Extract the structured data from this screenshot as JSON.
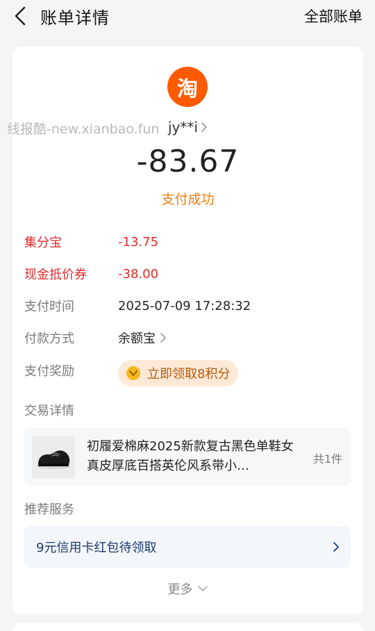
{
  "header": {
    "title": "账单详情",
    "all_bills": "全部账单"
  },
  "merchant": {
    "logo_char": "淘",
    "name": "jy**i",
    "logo_color": "#ff5a00"
  },
  "watermark": "线报酷-new.xianbao.fun",
  "transaction": {
    "amount": "-83.67",
    "status": "支付成功"
  },
  "details": {
    "jifenbao_label": "集分宝",
    "jifenbao_value": "-13.75",
    "coupon_label": "现金抵价券",
    "coupon_value": "-38.00",
    "time_label": "支付时间",
    "time_value": "2025-07-09 17:28:32",
    "method_label": "付款方式",
    "method_value": "余额宝",
    "reward_label": "支付奖励",
    "reward_value": "立即领取8积分"
  },
  "trade": {
    "section_title": "交易详情",
    "product_title": "初履爱棉麻2025新款复古黑色单鞋女真皮厚底百搭英伦风系带小…",
    "count": "共1件"
  },
  "recommend": {
    "section_title": "推荐服务",
    "promo": "9元信用卡红包待领取",
    "more": "更多"
  },
  "colors": {
    "accent_orange": "#f07d12",
    "discount_red": "#e12b2b",
    "background": "#f4f5f7"
  }
}
